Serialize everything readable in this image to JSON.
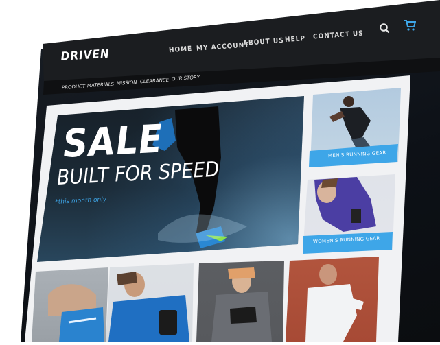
{
  "brand": "DRIVEN",
  "nav": [
    "HOME",
    "MY ACCOUNT",
    "ABOUT US",
    "HELP",
    "CONTACT US"
  ],
  "subnav": [
    "PRODUCT",
    "MATERIALS",
    "MISSION",
    "CLEARANCE",
    "OUR STORY"
  ],
  "hero": {
    "headline": "SALE",
    "subhead": "BUILT FOR SPEED",
    "note": "*this month only"
  },
  "side_tiles": [
    {
      "caption": "MEN'S RUNNING GEAR"
    },
    {
      "caption": "WOMEN'S RUNNING GEAR"
    }
  ],
  "icons": {
    "search": "search-icon",
    "cart": "cart-icon"
  },
  "colors": {
    "accent": "#3ea6e8",
    "header": "#1b1d20",
    "subnav": "#0f1012"
  }
}
